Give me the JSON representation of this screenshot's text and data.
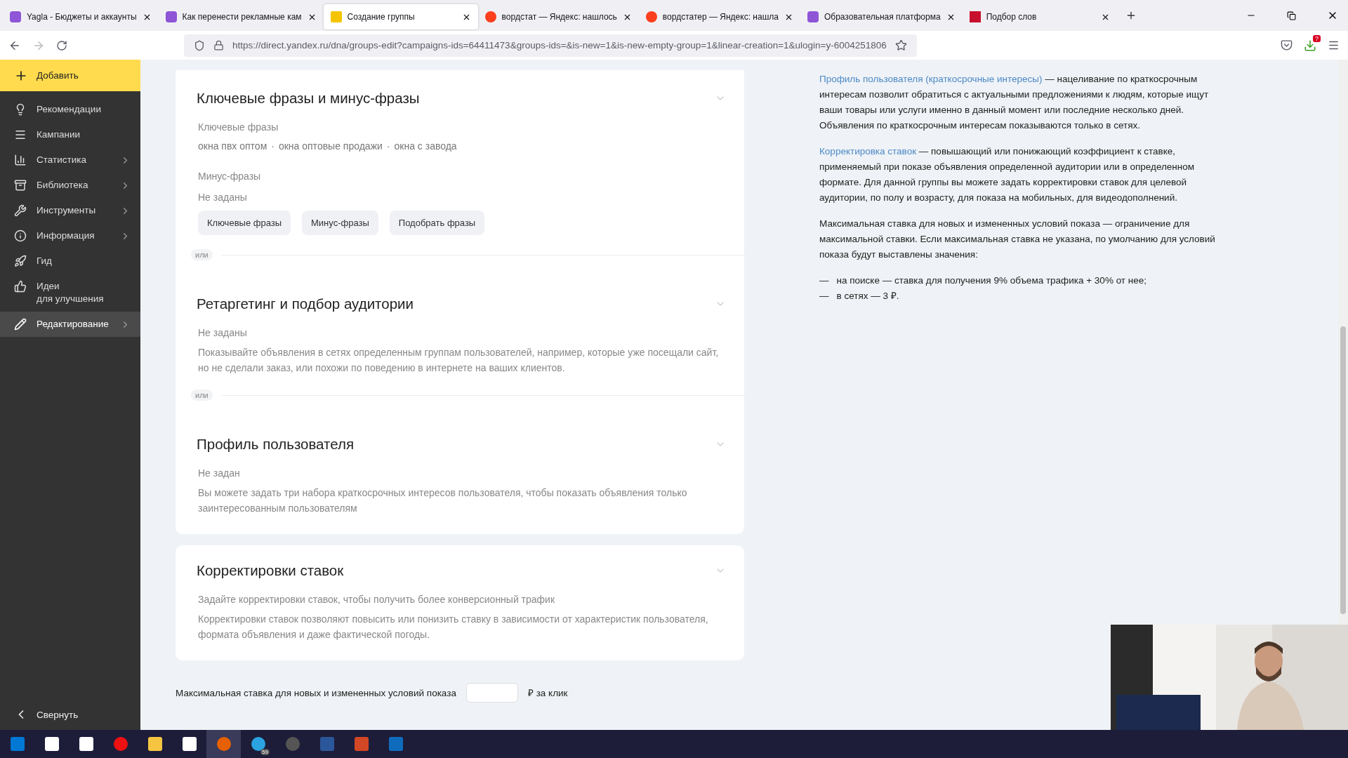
{
  "browser": {
    "tabs": [
      {
        "title": "Yagla - Бюджеты и аккаунты",
        "selected": false
      },
      {
        "title": "Как перенести рекламные кам",
        "selected": false
      },
      {
        "title": "Создание группы",
        "selected": true
      },
      {
        "title": "вордстат — Яндекс: нашлось",
        "selected": false
      },
      {
        "title": "вордстатер — Яндекс: нашла",
        "selected": false
      },
      {
        "title": "Образовательная платформа",
        "selected": false
      },
      {
        "title": "Подбор слов",
        "selected": false
      }
    ],
    "url": "https://direct.yandex.ru/dna/groups-edit?campaigns-ids=64411473&groups-ids=&is-new=1&is-new-empty-group=1&linear-creation=1&ulogin=y-6004251806",
    "download_badge": "?"
  },
  "sidebar": {
    "add_button": "Добавить",
    "items": [
      {
        "label": "Рекомендации",
        "submenu": false,
        "selected": false
      },
      {
        "label": "Кампании",
        "submenu": false,
        "selected": false
      },
      {
        "label": "Статистика",
        "submenu": true,
        "selected": false
      },
      {
        "label": "Библиотека",
        "submenu": true,
        "selected": false
      },
      {
        "label": "Инструменты",
        "submenu": true,
        "selected": false
      },
      {
        "label": "Информация",
        "submenu": true,
        "selected": false
      },
      {
        "label": "Гид",
        "submenu": false,
        "selected": false
      },
      {
        "label": "Идеи\nдля улучшения",
        "submenu": false,
        "selected": false
      },
      {
        "label": "Редактирование",
        "submenu": true,
        "selected": true
      }
    ],
    "collapse": "Свернуть"
  },
  "cards": [
    {
      "blocks": [
        {
          "kind": "heading",
          "text": "Ключевые фразы и минус-фразы"
        },
        {
          "kind": "label",
          "text": "Ключевые фразы"
        },
        {
          "kind": "phrases",
          "separator": "·",
          "items": [
            "окна пвх оптом",
            "окна оптовые продажи",
            "окна с завода"
          ]
        },
        {
          "kind": "label",
          "text": "Минус-фразы"
        },
        {
          "kind": "value",
          "text": "Не заданы"
        },
        {
          "kind": "buttons",
          "items": [
            "Ключевые фразы",
            "Минус-фразы",
            "Подобрать фразы"
          ]
        },
        {
          "kind": "or",
          "text": "или"
        },
        {
          "kind": "heading",
          "text": "Ретаргетинг и подбор аудитории"
        },
        {
          "kind": "value",
          "text": "Не заданы"
        },
        {
          "kind": "note",
          "text": "Показывайте объявления в сетях определенным группам пользователей, например, которые уже посещали сайт, но не сделали заказ, или похожи по поведению в интернете на ваших клиентов."
        },
        {
          "kind": "or",
          "text": "или"
        },
        {
          "kind": "heading",
          "text": "Профиль пользователя"
        },
        {
          "kind": "value",
          "text": "Не задан"
        },
        {
          "kind": "note",
          "text": "Вы можете задать три набора краткосрочных интересов пользователя, чтобы показать объявления только заинтересованным пользователям"
        }
      ]
    },
    {
      "blocks": [
        {
          "kind": "heading",
          "text": "Корректировки ставок"
        },
        {
          "kind": "value",
          "text": "Задайте корректировки ставок, чтобы получить более конверсионный трафик"
        },
        {
          "kind": "note",
          "text": "Корректировки ставок позволяют повысить или понизить ставку в зависимости от характеристик пользователя, формата объявления и даже фактической погоды."
        }
      ]
    }
  ],
  "max_bid": {
    "label": "Максимальная ставка для новых и измененных условий показа",
    "unit": "₽ за клик"
  },
  "help": {
    "paragraphs": [
      {
        "link": "Профиль пользователя (краткосрочные интересы)",
        "text": " — нацеливание по краткосрочным интересам позволит обратиться с актуальными предложениями к людям, которые ищут ваши товары или услуги именно в данный момент или последние несколько дней. Объявления по краткосрочным интересам показываются только в сетях."
      },
      {
        "link": "Корректировка ставок",
        "text": " — повышающий или понижающий коэффициент к ставке, применяемый при показе объявления определенной аудитории или в определенном формате. Для данной группы вы можете задать корректировки ставок для целевой аудитории, по полу и возрасту, для показа на мобильных, для видеодополнений."
      },
      {
        "text": "Максимальная ставка для новых и измененных условий показа — ограничение для максимальной ставки. Если максимальная ставка не указана, по умолчанию для условий показа будут выставлены значения:"
      }
    ],
    "list": [
      {
        "dash": "—",
        "text": "на поиске — ставка для получения 9% объема трафика + 30% от нее;"
      },
      {
        "dash": "—",
        "text": "в сетях — 3 ₽."
      }
    ]
  },
  "taskbar": {
    "badge": "59"
  }
}
